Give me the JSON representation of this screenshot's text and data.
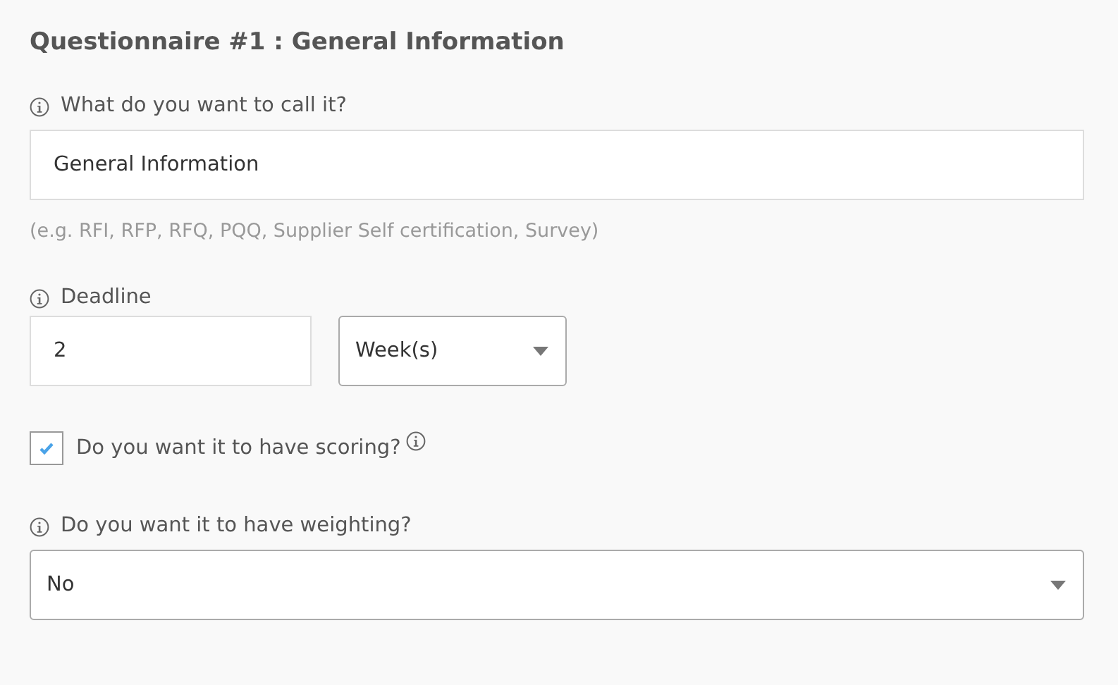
{
  "title": "Questionnaire #1 : General Information",
  "name_field": {
    "label": "What do you want to call it?",
    "value": "General Information"
  },
  "hint": "(e.g. RFI, RFP, RFQ, PQQ, Supplier Self certification, Survey)",
  "deadline": {
    "label": "Deadline",
    "value": "2",
    "unit": "Week(s)"
  },
  "scoring": {
    "label": "Do you want it to have scoring?",
    "checked": true
  },
  "weighting": {
    "label": "Do you want it to have weighting?",
    "value": "No"
  }
}
